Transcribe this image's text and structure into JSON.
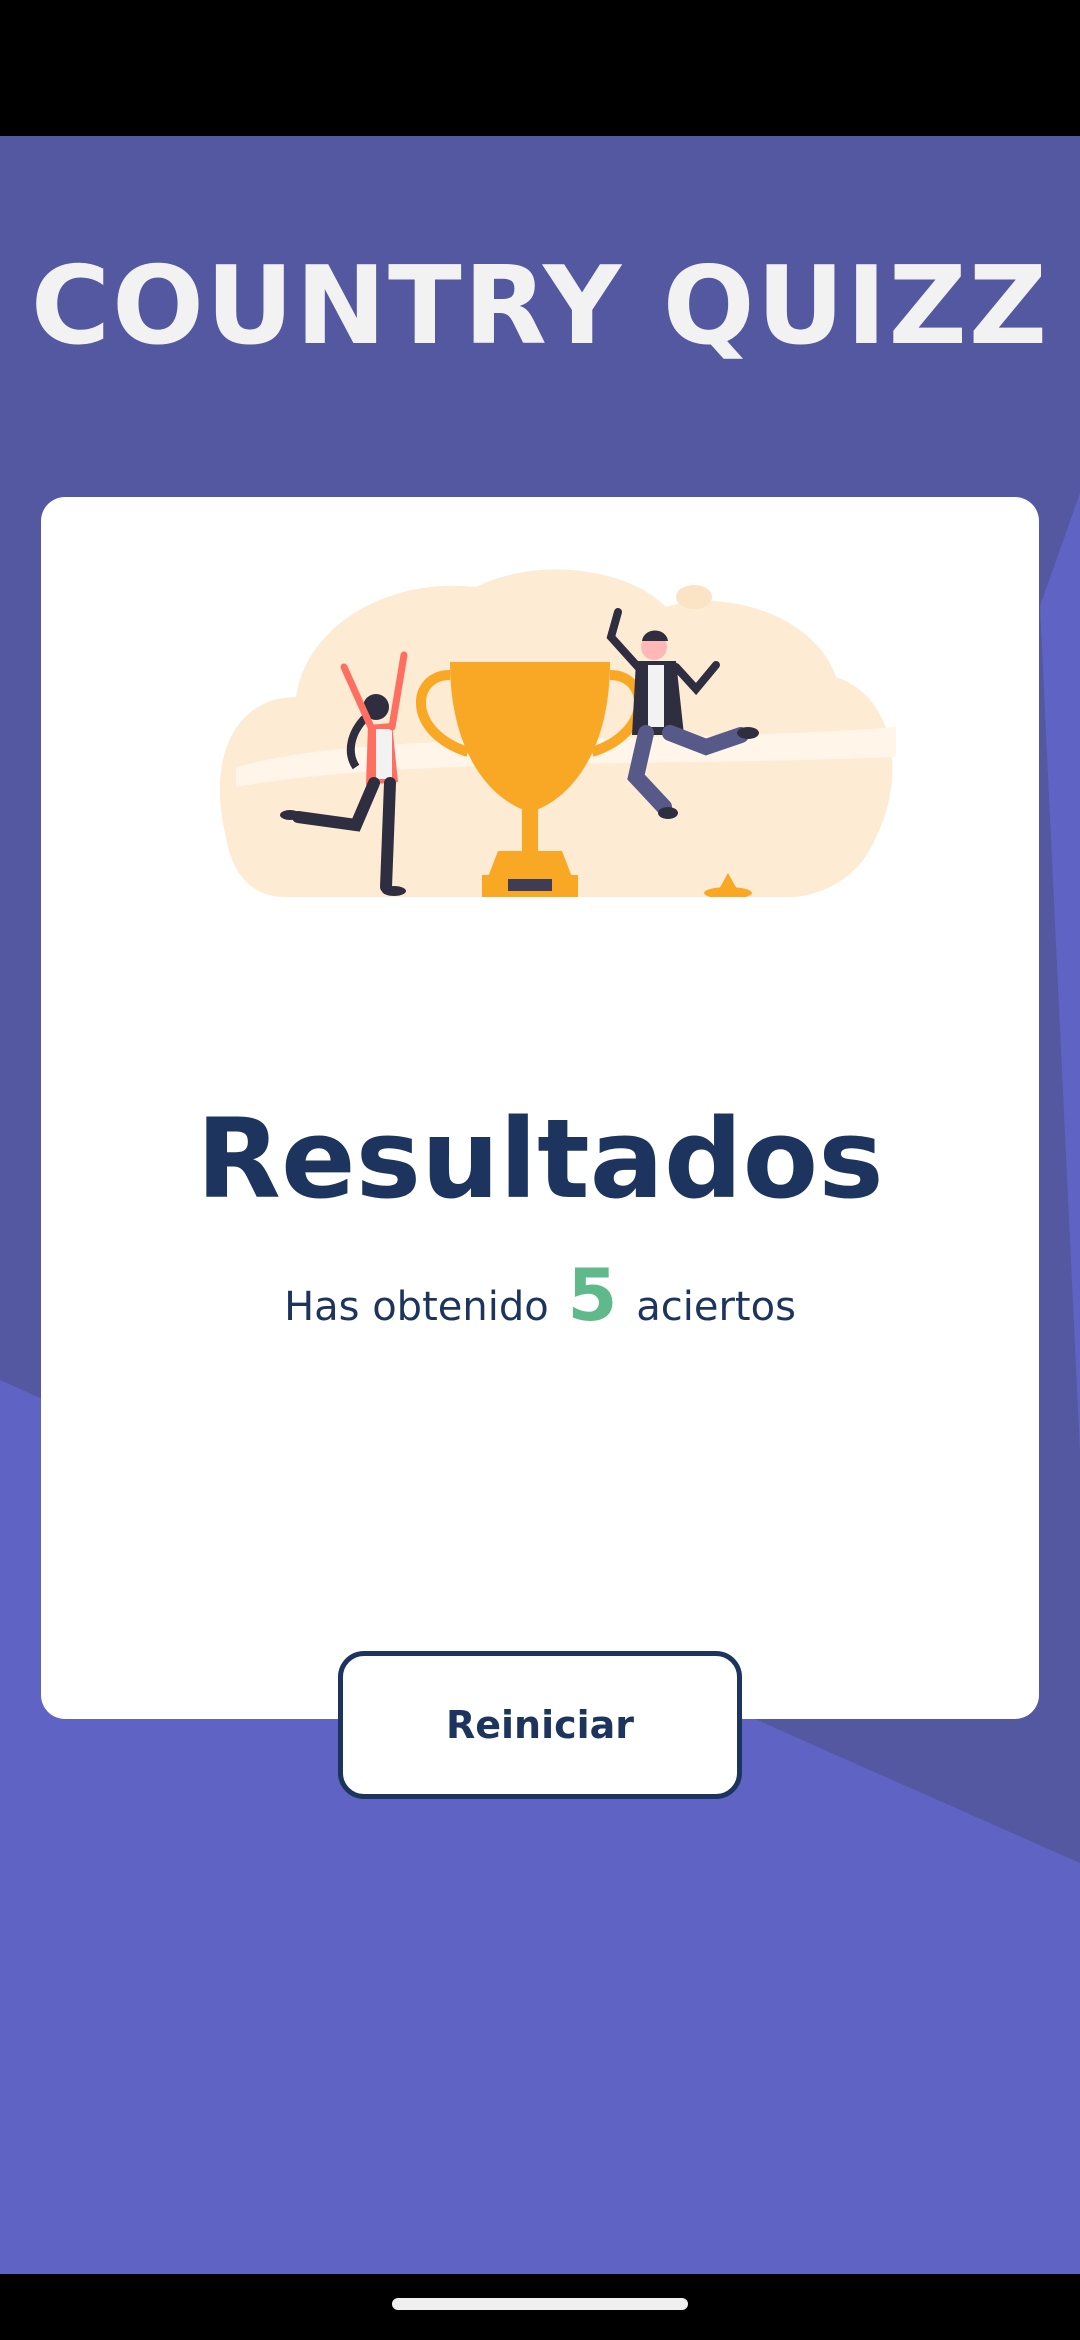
{
  "app": {
    "title": "COUNTRY QUIZZ"
  },
  "results": {
    "heading": "Resultados",
    "score_prefix": "Has obtenido",
    "score_value": "5",
    "score_suffix": "aciertos",
    "restart_label": "Reiniciar"
  },
  "colors": {
    "background": "#5f63c4",
    "background_dark": "#5358a0",
    "card": "#ffffff",
    "text_primary": "#1d355e",
    "score_accent": "#5fb98a",
    "trophy": "#f9a826",
    "illustration_bg": "#fdebd3"
  },
  "icons": {
    "illustration": "trophy-celebration-illustration"
  }
}
